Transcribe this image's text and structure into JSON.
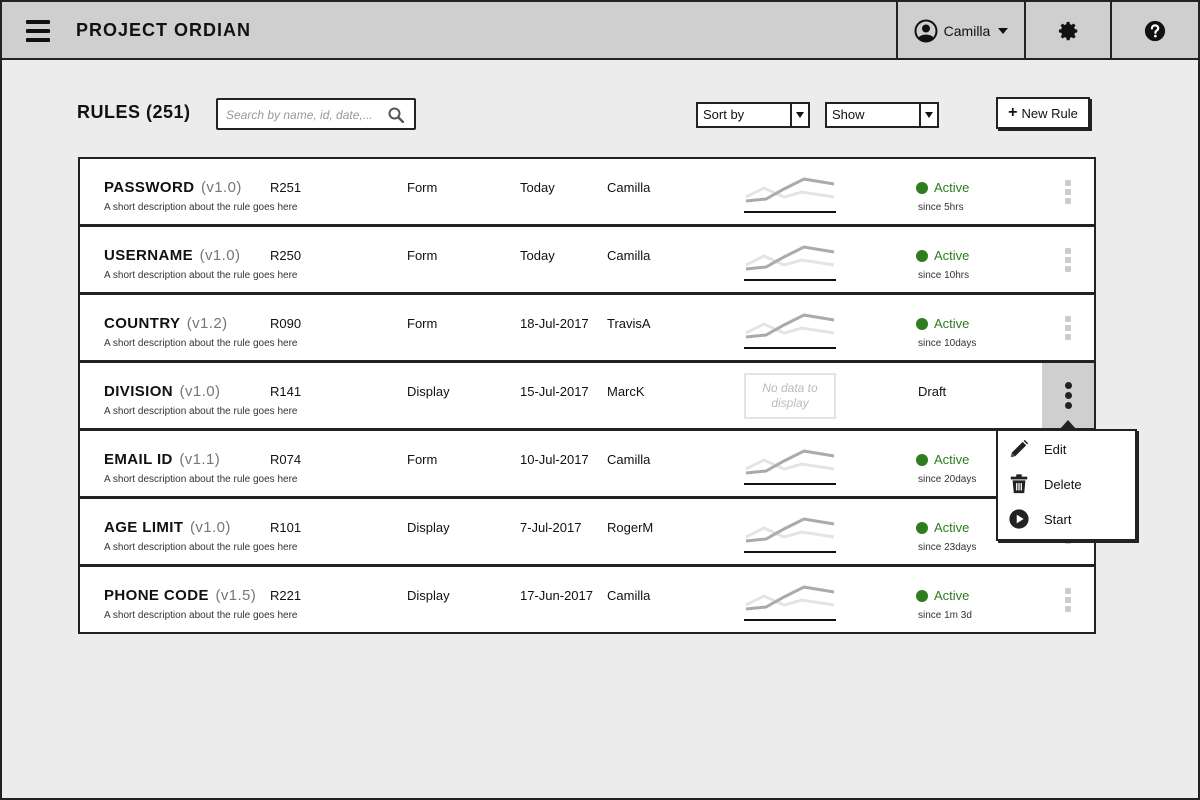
{
  "header": {
    "title": "PROJECT ORDIAN",
    "user_name": "Camilla"
  },
  "toolbar": {
    "rules_title": "RULES (251)",
    "search_placeholder": "Search by name, id, date,...",
    "sort_label": "Sort by",
    "show_label": "Show",
    "new_rule_label": "New Rule"
  },
  "colors": {
    "active": "#2e7d1f",
    "header_bg": "#cfcfcf",
    "page_bg": "#ececec"
  },
  "rules": [
    {
      "name": "PASSWORD",
      "version": "(v1.0)",
      "description": "A short description about the rule goes here",
      "id": "R251",
      "type": "Form",
      "date": "Today",
      "owner": "Camilla",
      "status": "Active",
      "since": "since 5hrs",
      "has_chart": true
    },
    {
      "name": "USERNAME",
      "version": "(v1.0)",
      "description": "A short description about the rule goes here",
      "id": "R250",
      "type": "Form",
      "date": "Today",
      "owner": "Camilla",
      "status": "Active",
      "since": "since 10hrs",
      "has_chart": true
    },
    {
      "name": "COUNTRY",
      "version": "(v1.2)",
      "description": "A short description about the rule goes here",
      "id": "R090",
      "type": "Form",
      "date": "18-Jul-2017",
      "owner": "TravisA",
      "status": "Active",
      "since": "since 10days",
      "has_chart": true
    },
    {
      "name": "DIVISION",
      "version": "(v1.0)",
      "description": "A short description about the rule goes here",
      "id": "R141",
      "type": "Display",
      "date": "15-Jul-2017",
      "owner": "MarcK",
      "status": "Draft",
      "since": "",
      "has_chart": false,
      "no_data_text": "No data to display",
      "menu_open": true
    },
    {
      "name": "EMAIL ID",
      "version": "(v1.1)",
      "description": "A short description about the rule goes here",
      "id": "R074",
      "type": "Form",
      "date": "10-Jul-2017",
      "owner": "Camilla",
      "status": "Active",
      "since": "since 20days",
      "has_chart": true
    },
    {
      "name": "AGE LIMIT",
      "version": "(v1.0)",
      "description": "A short description about the rule goes here",
      "id": "R101",
      "type": "Display",
      "date": "7-Jul-2017",
      "owner": "RogerM",
      "status": "Active",
      "since": "since 23days",
      "has_chart": true
    },
    {
      "name": "PHONE CODE",
      "version": "(v1.5)",
      "description": "A short description about the rule goes here",
      "id": "R221",
      "type": "Display",
      "date": "17-Jun-2017",
      "owner": "Camilla",
      "status": "Active",
      "since": "since 1m 3d",
      "has_chart": true
    }
  ],
  "context_menu": {
    "items": [
      {
        "label": "Edit",
        "icon": "pencil-icon"
      },
      {
        "label": "Delete",
        "icon": "trash-icon"
      },
      {
        "label": "Start",
        "icon": "play-icon"
      }
    ]
  }
}
